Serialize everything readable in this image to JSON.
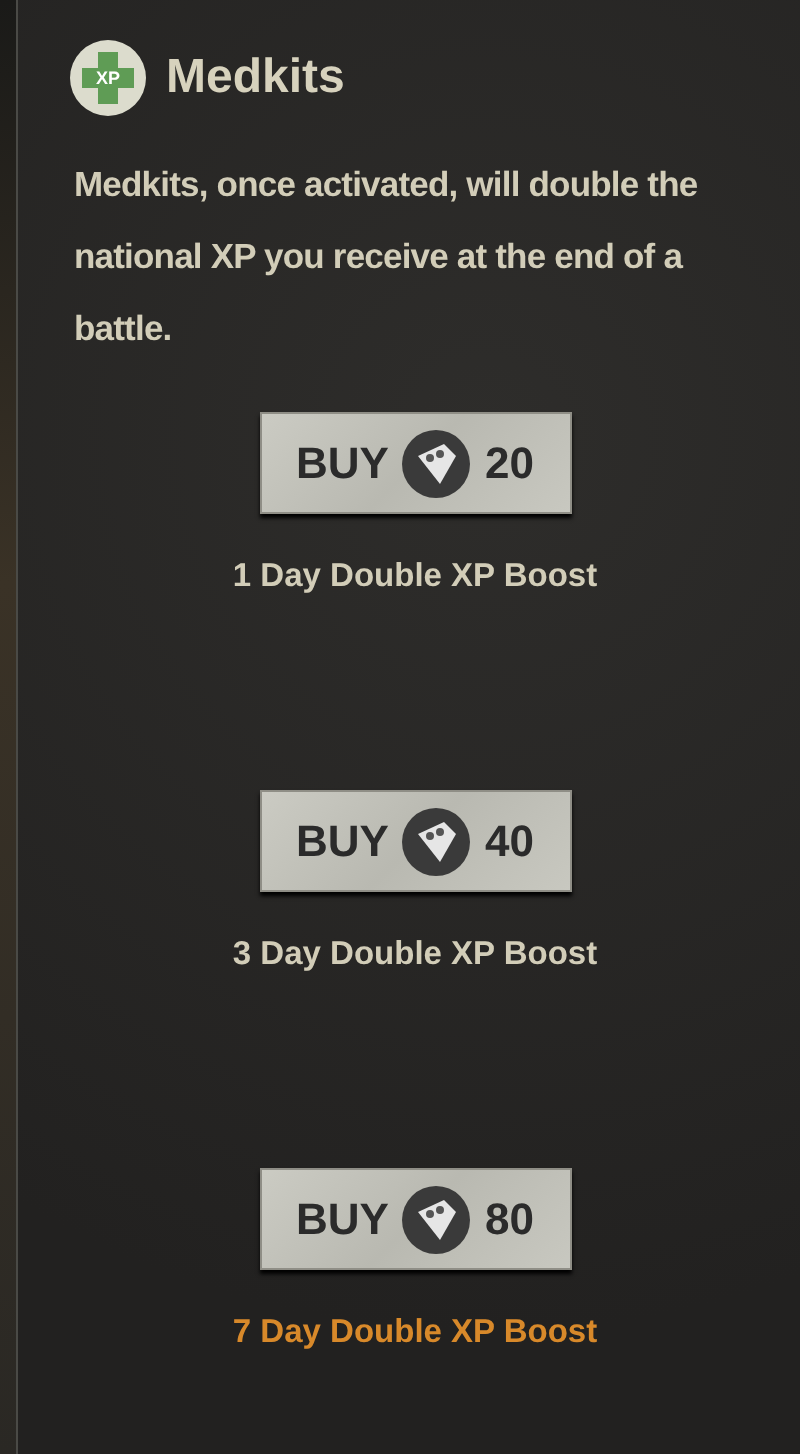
{
  "header": {
    "icon_text": "XP",
    "title": "Medkits"
  },
  "description": "Medkits, once activated, will double the national XP you receive at the end of a battle.",
  "offers": [
    {
      "button_text": "BUY",
      "price": "20",
      "label": "1 Day Double XP Boost",
      "highlighted": false
    },
    {
      "button_text": "BUY",
      "price": "40",
      "label": "3 Day Double XP Boost",
      "highlighted": false
    },
    {
      "button_text": "BUY",
      "price": "80",
      "label": "7 Day Double XP Boost",
      "highlighted": true
    }
  ]
}
